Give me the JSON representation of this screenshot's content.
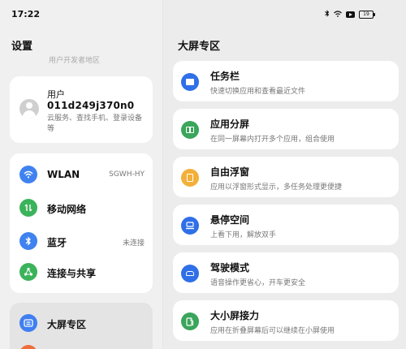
{
  "status_bar": {
    "time": "17:22",
    "icons": [
      "bluetooth-icon",
      "wifi-icon",
      "video-icon",
      "battery-icon"
    ],
    "battery": "19"
  },
  "settings": {
    "title": "设置",
    "faded_text": "用户开发者地区",
    "account": {
      "label": "用户",
      "id": "011d249j370n0",
      "description": "云服务、查找手机、登录设备等"
    },
    "items": [
      {
        "label": "WLAN",
        "value": "SGWH-HY",
        "icon": "wifi-icon",
        "color": "#3f82f0"
      },
      {
        "label": "移动网络",
        "value": "",
        "icon": "mobile-network-icon",
        "color": "#3bb35a"
      },
      {
        "label": "蓝牙",
        "value": "未连接",
        "icon": "bluetooth-icon",
        "color": "#3f82f0"
      },
      {
        "label": "连接与共享",
        "value": "",
        "icon": "share-icon",
        "color": "#3bb35a"
      }
    ],
    "selected": {
      "label": "大屏专区",
      "icon": "large-screen-icon",
      "color": "#3f7ff0"
    }
  },
  "detail": {
    "title": "大屏专区",
    "features": [
      {
        "title": "任务栏",
        "desc": "快速切换应用和查看最近文件",
        "icon": "taskbar-icon",
        "color": "#2f6fe8"
      },
      {
        "title": "应用分屏",
        "desc": "在同一屏幕内打开多个应用，组合使用",
        "icon": "split-screen-icon",
        "color": "#3aa55b"
      },
      {
        "title": "自由浮窗",
        "desc": "应用以浮窗形式显示，多任务处理更便捷",
        "icon": "floating-window-icon",
        "color": "#f2b03a"
      },
      {
        "title": "悬停空间",
        "desc": "上看下用，解放双手",
        "icon": "hover-space-icon",
        "color": "#2f6fe8"
      },
      {
        "title": "驾驶模式",
        "desc": "语音操作更省心，开车更安全",
        "icon": "car-icon",
        "color": "#2f6fe8"
      },
      {
        "title": "大小屏接力",
        "desc": "应用在折叠屏幕后可以继续在小屏使用",
        "icon": "screen-relay-icon",
        "color": "#3aa55b"
      }
    ]
  }
}
